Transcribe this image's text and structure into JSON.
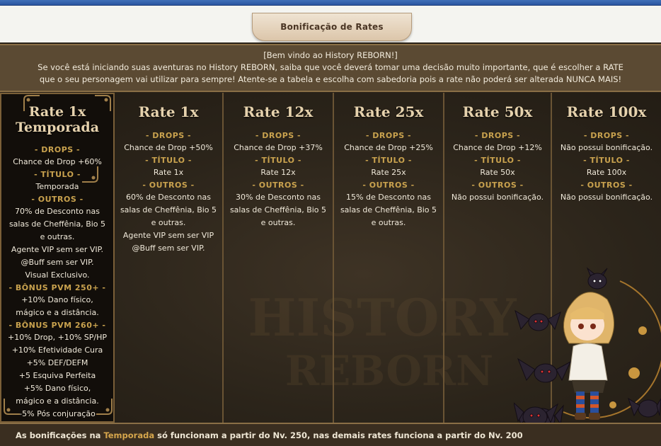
{
  "header": {
    "title": "Bonificação de Rates"
  },
  "intro": {
    "line1": "[Bem vindo ao History REBORN!]",
    "line2": "Se você está iniciando suas aventuras no History REBORN, saiba que você deverá tomar uma decisão muito importante, que é escolher a RATE",
    "line3": "que o seu personagem vai utilizar para sempre! Atente-se a tabela e escolha com sabedoria pois a rate não poderá ser alterada NUNCA MAIS!"
  },
  "sections": {
    "drops": "- DROPS -",
    "titulo": "- TÍTULO -",
    "outros": "- OUTROS -",
    "bonus250": "- BÔNUS PVM 250+ -",
    "bonus260": "- BÔNUS PVM 260+ -"
  },
  "columns": [
    {
      "title_line1": "Rate 1x",
      "title_line2": "Temporada",
      "drops": "Chance de Drop +60%",
      "titulo": "Temporada",
      "outros": [
        "70% de Desconto nas",
        "salas de Cheffênia, Bio 5",
        "e outras.",
        "Agente VIP sem ser VIP.",
        "@Buff sem ser VIP.",
        "Visual Exclusivo."
      ],
      "bonus250": [
        "+10% Dano físico,",
        "mágico e a distância."
      ],
      "bonus260": [
        "+10% Drop, +10% SP/HP",
        "+10% Efetividade Cura",
        "+5% DEF/DEFM",
        "+5 Esquiva Perfeita",
        "+5% Dano físico,",
        "mágico e a distância.",
        "-5% Pós conjuração"
      ]
    },
    {
      "title": "Rate 1x",
      "drops": "Chance de Drop +50%",
      "titulo": "Rate 1x",
      "outros": [
        "60% de Desconto nas",
        "salas de Cheffênia, Bio 5",
        "e outras.",
        "Agente VIP sem ser VIP",
        "@Buff sem ser VIP."
      ]
    },
    {
      "title": "Rate 12x",
      "drops": "Chance de Drop +37%",
      "titulo": "Rate 12x",
      "outros": [
        "30% de Desconto nas",
        "salas de Cheffênia, Bio 5",
        "e outras."
      ]
    },
    {
      "title": "Rate 25x",
      "drops": "Chance de Drop +25%",
      "titulo": "Rate 25x",
      "outros": [
        "15% de Desconto nas",
        "salas de Cheffênia, Bio 5",
        "e outras."
      ]
    },
    {
      "title": "Rate 50x",
      "drops": "Chance de Drop +12%",
      "titulo": "Rate 50x",
      "outros": [
        "Não possui bonificação."
      ]
    },
    {
      "title": "Rate 100x",
      "drops": "Não possui bonificação.",
      "titulo": "Rate 100x",
      "outros": [
        "Não possui bonificação."
      ]
    }
  ],
  "watermark": {
    "line1": "HISTORY",
    "line2": "REBORN"
  },
  "footer": {
    "before": "As bonificações na ",
    "highlight": "Temporada",
    "after": " só funcionam a partir do Nv. 250, nas demais rates funciona a partir do Nv. 200"
  },
  "colors": {
    "accent_gold": "#c9a24e",
    "panel_brown": "#5b4a33",
    "table_dark": "#2b241a"
  },
  "icons": [
    "corner-ornament-icon",
    "bat-icon",
    "moon-icon"
  ]
}
